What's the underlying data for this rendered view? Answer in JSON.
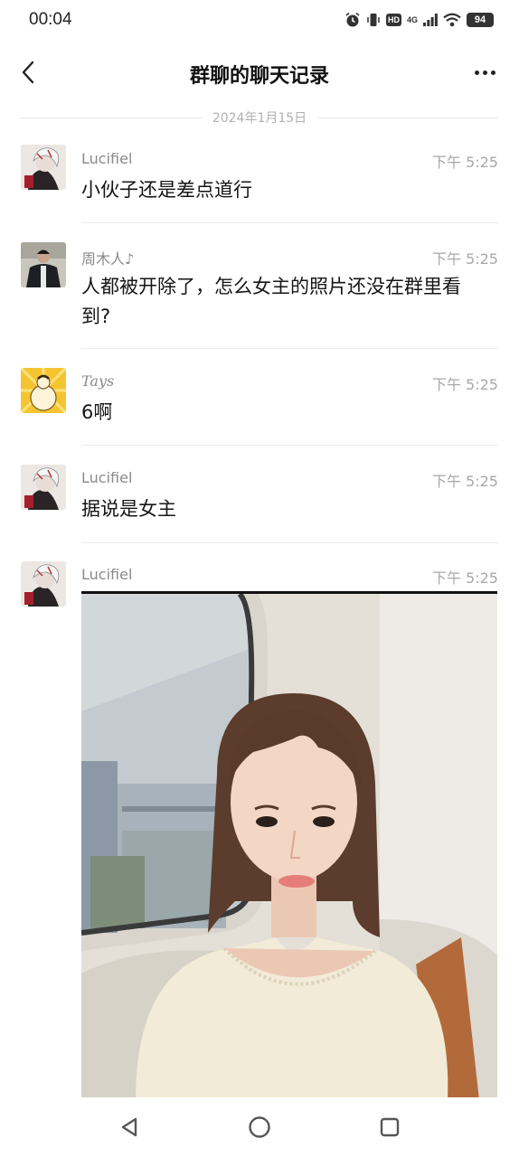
{
  "status_bar": {
    "time": "00:04",
    "network": "4G",
    "hd": "HD",
    "battery": "94",
    "icons": [
      "alarm-icon",
      "vibrate-icon",
      "hd-icon",
      "signal-icon",
      "wifi-icon",
      "battery-icon"
    ]
  },
  "header": {
    "title": "群聊的聊天记录",
    "back_icon": "back-arrow-icon",
    "more_icon": "more-icon"
  },
  "date_divider": "2024年1月15日",
  "messages": [
    {
      "sender": "Lucifiel",
      "time": "下午 5:25",
      "text": "小伙子还是差点道行"
    },
    {
      "sender": "周木人♪",
      "time": "下午 5:25",
      "text": "人都被开除了，怎么女主的照片还没在群里看到?"
    },
    {
      "sender": "Tays",
      "time": "下午 5:25",
      "text": "6啊"
    },
    {
      "sender": "Lucifiel",
      "time": "下午 5:25",
      "text": "据说是女主"
    },
    {
      "sender": "Lucifiel",
      "time": "下午 5:25",
      "text": ""
    }
  ],
  "nav_bar": {
    "icons": [
      "nav-back-icon",
      "nav-home-icon",
      "nav-recents-icon"
    ]
  },
  "colors": {
    "background": "#ffffff",
    "title": "#111111",
    "sender": "#8a8a8a",
    "time": "#a8a8a8",
    "divider": "#ececec"
  }
}
